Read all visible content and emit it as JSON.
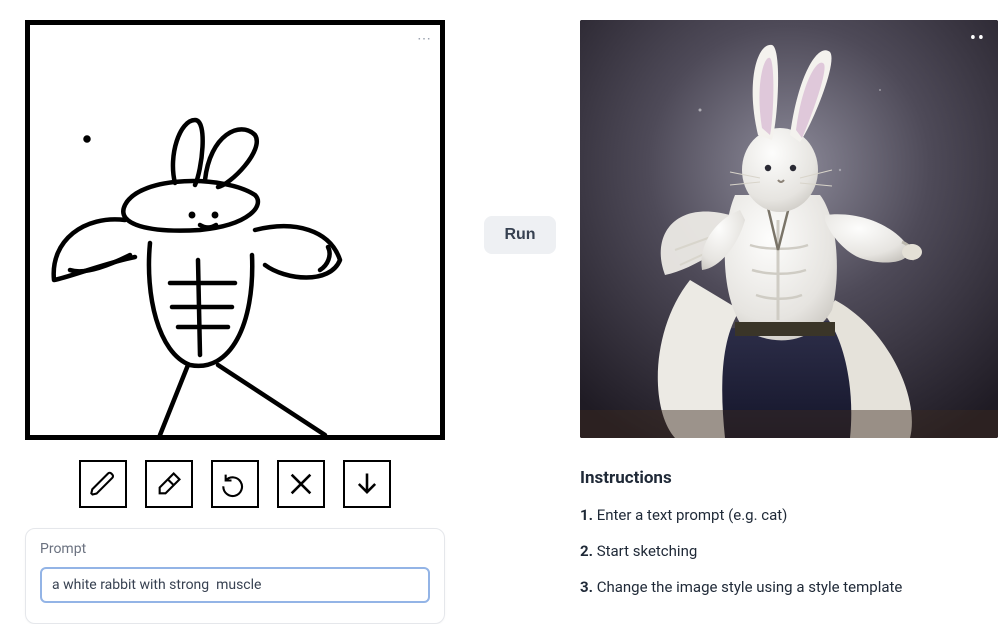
{
  "toolbar": {
    "pencil": "pencil-icon",
    "eraser": "eraser-icon",
    "undo": "undo-icon",
    "clear": "close-icon",
    "download": "download-arrow-icon"
  },
  "prompt": {
    "label": "Prompt",
    "value": "a white rabbit with strong  muscle"
  },
  "run_label": "Run",
  "instructions": {
    "heading": "Instructions",
    "items": [
      "Enter a text prompt (e.g. cat)",
      "Start sketching",
      "Change the image style using a style template"
    ]
  }
}
